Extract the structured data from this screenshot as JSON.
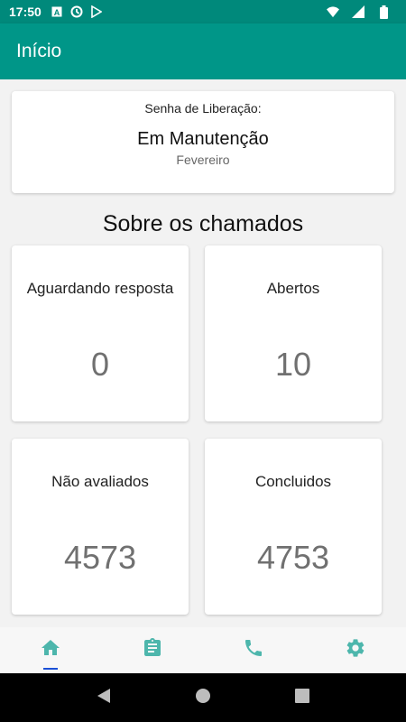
{
  "status_bar": {
    "time": "17:50",
    "icons": [
      "a-icon",
      "sync-icon",
      "play-store-icon"
    ],
    "right_icons": [
      "wifi-icon",
      "signal-icon",
      "battery-icon"
    ]
  },
  "app_bar": {
    "title": "Início"
  },
  "password_card": {
    "label": "Senha de Liberação:",
    "value": "Em Manutenção",
    "month": "Fevereiro"
  },
  "section": {
    "title": "Sobre os chamados"
  },
  "stats": [
    {
      "label": "Aguardando resposta",
      "value": "0"
    },
    {
      "label": "Abertos",
      "value": "10"
    },
    {
      "label": "Não avaliados",
      "value": "4573"
    },
    {
      "label": "Concluidos",
      "value": "4753"
    }
  ],
  "bottom_nav": {
    "items": [
      "home-icon",
      "clipboard-icon",
      "phone-icon",
      "settings-icon"
    ],
    "active_index": 0,
    "accent": "#4db6ac"
  },
  "colors": {
    "primary": "#009688",
    "status_bar": "#00897b",
    "indicator": "#1a4fd6"
  }
}
